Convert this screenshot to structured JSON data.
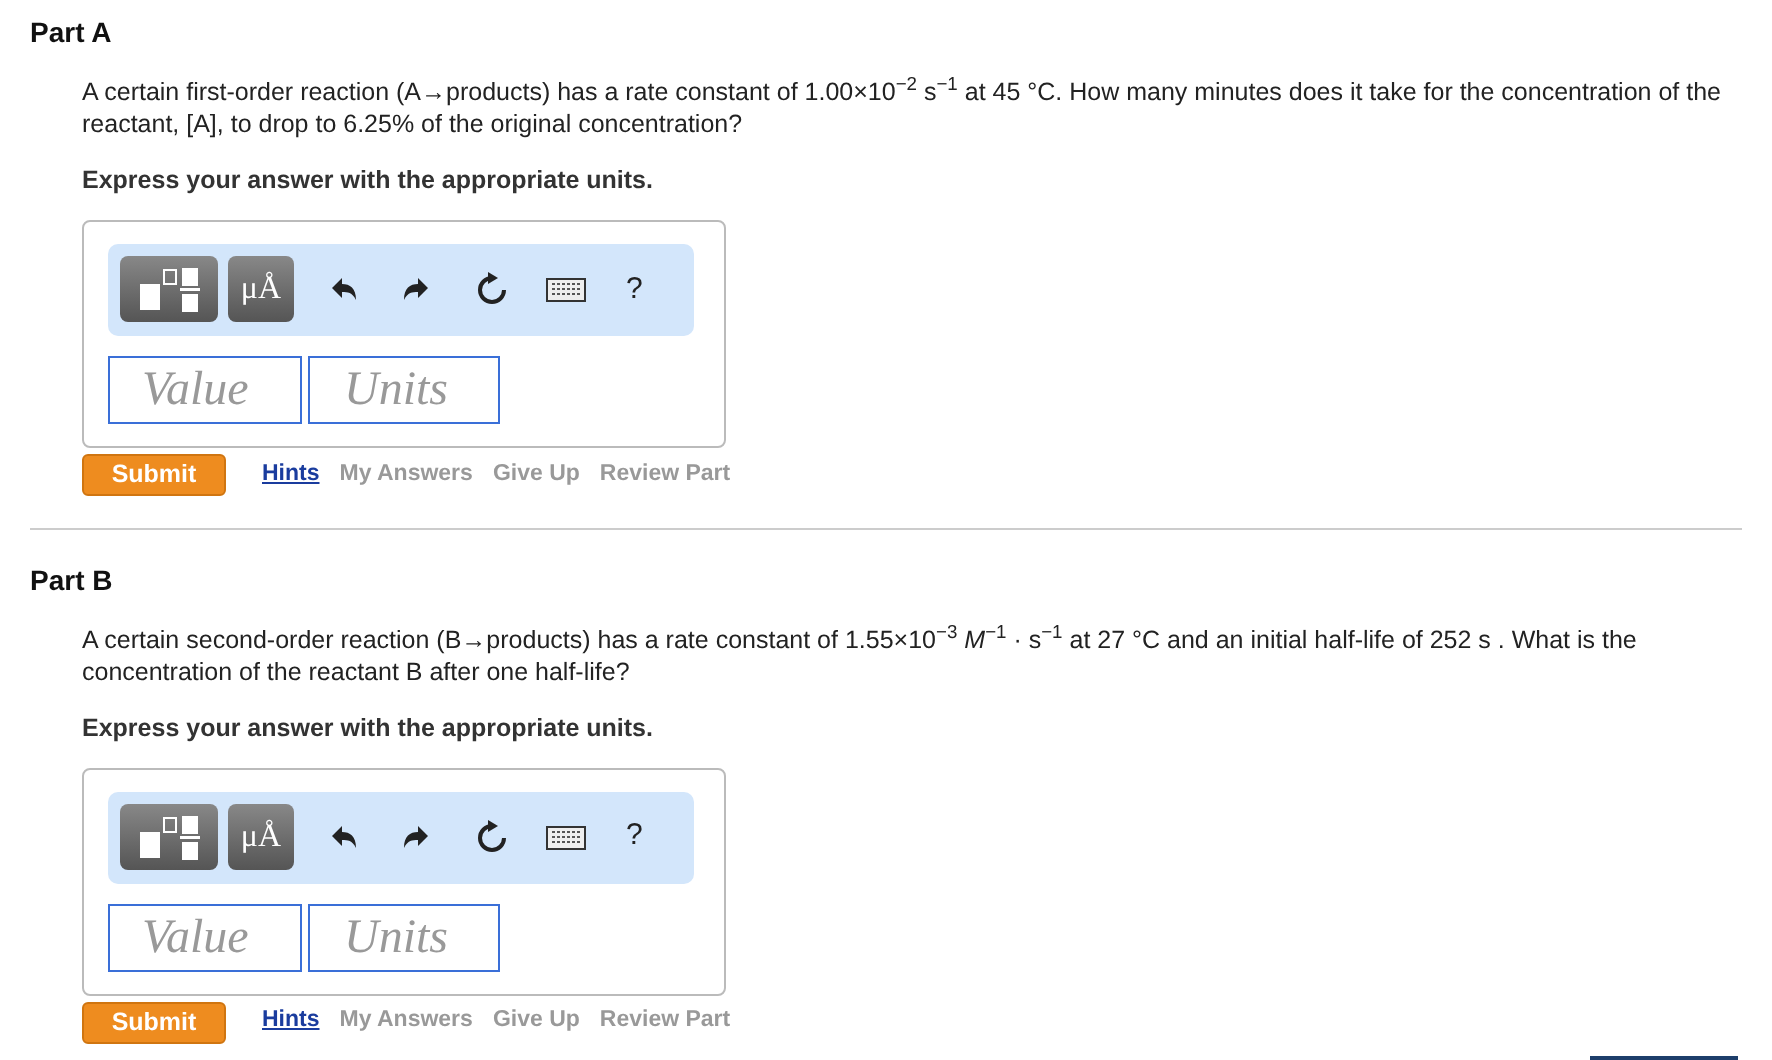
{
  "parts": [
    {
      "title": "Part A",
      "question": "A certain first-order reaction (A→products) has a rate constant of 1.00×10$^{−2}$ s$^{−1}$ at 45 °C. How many minutes does it take for the concentration of the reactant, [A], to drop to 6.25% of the original concentration?",
      "instruction": "Express your answer with the appropriate units.",
      "toolbar": {
        "units_key": "μÅ",
        "help": "?"
      },
      "value_placeholder": "Value",
      "units_placeholder": "Units",
      "submit": "Submit",
      "links": [
        {
          "label": "Hints",
          "disabled": false
        },
        {
          "label": "My Answers",
          "disabled": true
        },
        {
          "label": "Give Up",
          "disabled": true
        },
        {
          "label": "Review Part",
          "disabled": true
        }
      ]
    },
    {
      "title": "Part B",
      "question": "A certain second-order reaction (B→products) has a rate constant of 1.55×10$^{−3}$ *M*$^{−1}$ · s$^{−1}$ at 27 °C and an initial half-life of 252 s . What is the concentration of the reactant B after one half-life?",
      "instruction": "Express your answer with the appropriate units.",
      "toolbar": {
        "units_key": "μÅ",
        "help": "?"
      },
      "value_placeholder": "Value",
      "units_placeholder": "Units",
      "submit": "Submit",
      "links": [
        {
          "label": "Hints",
          "disabled": false
        },
        {
          "label": "My Answers",
          "disabled": true
        },
        {
          "label": "Give Up",
          "disabled": true
        },
        {
          "label": "Review Part",
          "disabled": true
        }
      ]
    }
  ]
}
